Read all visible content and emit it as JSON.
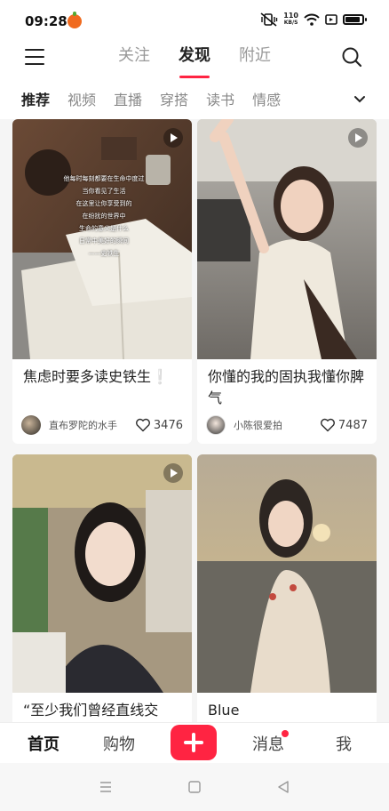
{
  "status_bar": {
    "time": "09:28",
    "speed_value": "110",
    "speed_unit": "KB/S",
    "battery_level": 0.9
  },
  "top_nav": {
    "tabs": [
      {
        "label": "关注",
        "active": false
      },
      {
        "label": "发现",
        "active": true
      },
      {
        "label": "附近",
        "active": false
      }
    ]
  },
  "categories": {
    "items": [
      "推荐",
      "视频",
      "直播",
      "穿搭",
      "读书",
      "情感"
    ],
    "active_index": 0
  },
  "feed": {
    "cards": [
      {
        "title": "焦虑时要多读史铁生❕",
        "author": "直布罗陀的水手",
        "likes": "3476",
        "is_video": true,
        "image_text": [
          "他每时每刻都要在生命中度过",
          "当你看见了生活",
          "在这里让你享受到的",
          "在纷扰的世界中",
          "生命的意义是什么",
          "日常中美好的瞬间",
          "——史铁生"
        ]
      },
      {
        "title": "你懂的我的固执我懂你脾气",
        "author": "小陈很爱拍",
        "likes": "7487",
        "is_video": true
      },
      {
        "title": "“至少我们曾经直线交",
        "is_video": true
      },
      {
        "title": "Blue",
        "is_video": false
      }
    ]
  },
  "tab_bar": {
    "home": "首页",
    "shop": "购物",
    "messages": "消息",
    "me": "我",
    "messages_has_badge": true
  },
  "colors": {
    "accent": "#ff2442"
  }
}
